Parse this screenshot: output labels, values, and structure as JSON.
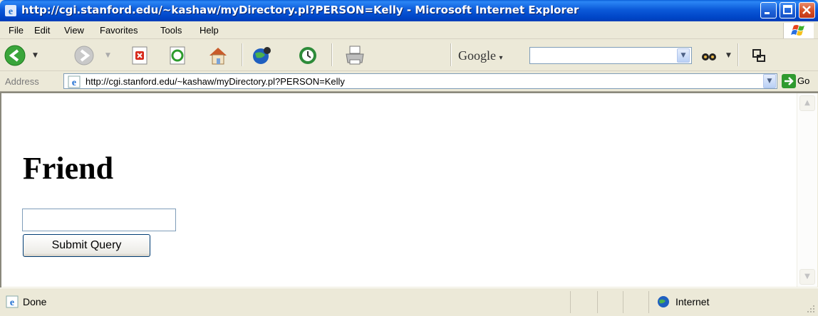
{
  "window": {
    "title": "http://cgi.stanford.edu/~kashaw/myDirectory.pl?PERSON=Kelly - Microsoft Internet Explorer"
  },
  "menu": [
    "File",
    "Edit",
    "View",
    "Favorites",
    "Tools",
    "Help"
  ],
  "toolbar": {
    "search_provider": "Google",
    "search_value": ""
  },
  "address": {
    "label": "Address",
    "url": "http://cgi.stanford.edu/~kashaw/myDirectory.pl?PERSON=Kelly",
    "go_label": "Go"
  },
  "page": {
    "heading": "Friend",
    "input_value": "",
    "submit_label": "Submit Query"
  },
  "status": {
    "text": "Done",
    "zone": "Internet"
  },
  "colors": {
    "titlebar": "#0b5ad9",
    "chrome": "#ece9d8"
  }
}
